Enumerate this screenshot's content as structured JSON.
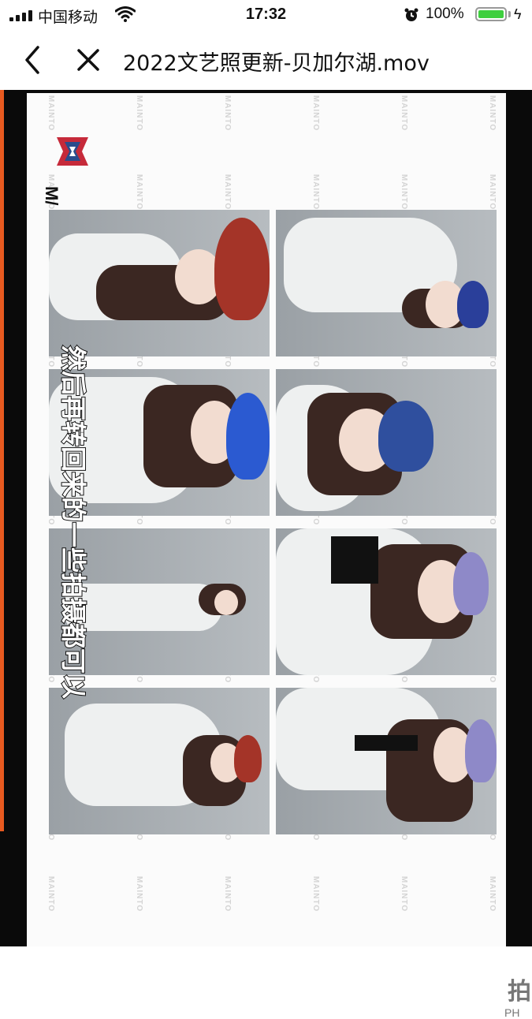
{
  "status_bar": {
    "carrier": "中国移动",
    "time": "17:32",
    "battery_percent": "100%",
    "battery_level": 1.0,
    "battery_color": "#3ecf3e"
  },
  "nav": {
    "title": "2022文艺照更新-贝加尔湖.mov"
  },
  "video": {
    "caption": "然后再转回来的一些拍摄都可以",
    "brand_text": "M/",
    "watermark_text": "MAINTO",
    "corner_text": "PH",
    "accent_color": "#e85a20"
  },
  "icons": {
    "back": "chevron-left-icon",
    "close": "close-icon",
    "signal": "signal-icon",
    "wifi": "wifi-icon",
    "alarm": "alarm-icon",
    "battery": "battery-icon",
    "charging": "bolt-icon"
  }
}
